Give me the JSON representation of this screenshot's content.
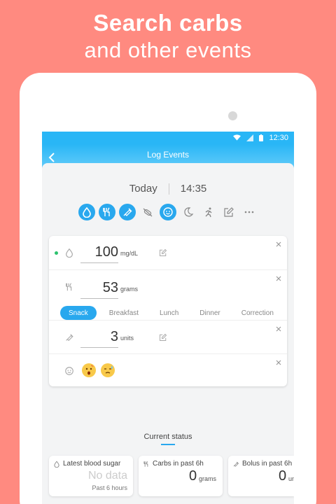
{
  "promo": {
    "line1": "Search carbs",
    "line2": "and other events"
  },
  "status_bar": {
    "time": "12:30"
  },
  "app_bar": {
    "title": "Log Events"
  },
  "datetime": {
    "day": "Today",
    "time": "14:35"
  },
  "event_icons": [
    {
      "name": "blood-drop-icon",
      "active": true
    },
    {
      "name": "fork-knife-icon",
      "active": true
    },
    {
      "name": "syringe-icon",
      "active": true
    },
    {
      "name": "pill-icon",
      "active": false
    },
    {
      "name": "smiley-icon",
      "active": true
    },
    {
      "name": "moon-icon",
      "active": false
    },
    {
      "name": "running-icon",
      "active": false
    },
    {
      "name": "note-icon",
      "active": false
    },
    {
      "name": "more-icon",
      "active": false
    }
  ],
  "entries": {
    "blood_sugar": {
      "value": "100",
      "unit": "mg/dL"
    },
    "carbs": {
      "value": "53",
      "unit": "grams",
      "meal_tabs": [
        "Snack",
        "Breakfast",
        "Lunch",
        "Dinner",
        "Correction"
      ],
      "selected_meal": "Snack"
    },
    "bolus": {
      "value": "3",
      "unit": "units"
    },
    "mood": {
      "emojis": [
        "surprised-face-icon",
        "sad-sweat-face-icon"
      ]
    }
  },
  "current_status": {
    "title": "Current status",
    "cards": [
      {
        "title": "Latest blood sugar",
        "value": "No data",
        "sub": "Past 6 hours"
      },
      {
        "title": "Carbs in past 6h",
        "value": "0",
        "unit": "grams"
      },
      {
        "title": "Bolus in past 6h",
        "value": "0",
        "unit": "units"
      }
    ]
  },
  "colors": {
    "background": "#FF8A80",
    "accent": "#29A8EE",
    "status_dot": "#2DC26E"
  }
}
